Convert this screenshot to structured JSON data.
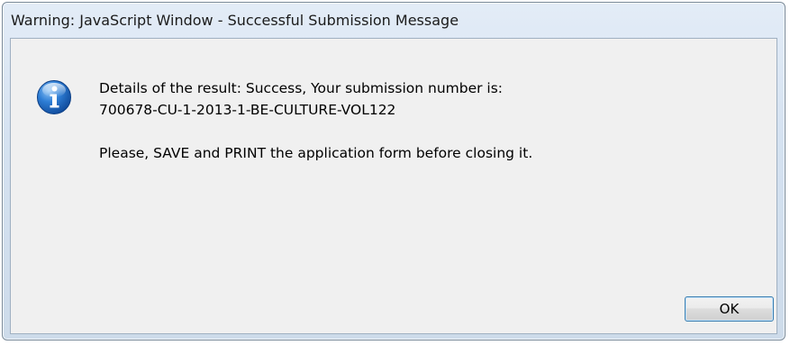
{
  "window": {
    "title": "Warning: JavaScript Window - Successful Submission Message"
  },
  "message": {
    "icon": "info-icon",
    "line1": "Details of the result: Success, Your submission number is:",
    "line2": "700678-CU-1-2013-1-BE-CULTURE-VOL122",
    "line3": "Please, SAVE and PRINT the application form before closing it."
  },
  "buttons": {
    "ok_label": "OK"
  },
  "colors": {
    "info_icon_blue": "#1a5fb4",
    "focus_border": "#3c7fb1"
  }
}
